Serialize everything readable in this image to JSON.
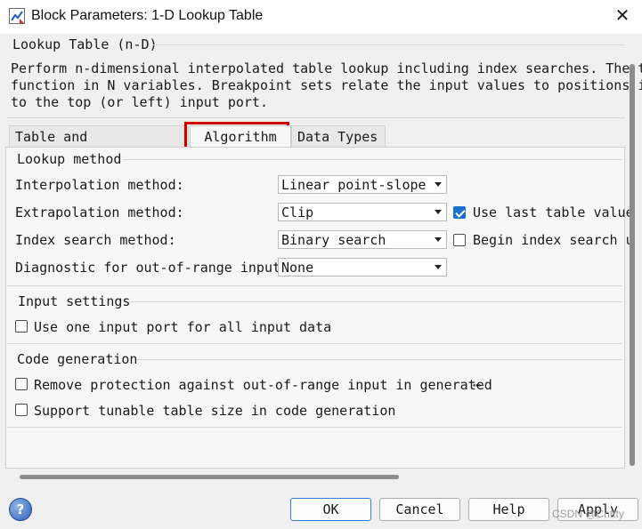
{
  "window": {
    "title": "Block Parameters: 1-D Lookup Table",
    "close_glyph": "✕"
  },
  "block": {
    "name": "Lookup Table (n-D)",
    "description_lines": [
      "Perform n-dimensional interpolated table lookup including index searches. The tab",
      "function in N variables. Breakpoint sets relate the input values to positions in",
      "to the top (or left) input port."
    ]
  },
  "tabs": [
    {
      "label": "Table and Breakpoints",
      "active": false
    },
    {
      "label": "Algorithm",
      "active": true
    },
    {
      "label": "Data Types",
      "active": false
    }
  ],
  "lookup_method": {
    "title": "Lookup method",
    "interpolation": {
      "label": "Interpolation method:",
      "value": "Linear point-slope"
    },
    "extrapolation": {
      "label": "Extrapolation method:",
      "value": "Clip"
    },
    "index_search": {
      "label": "Index search method:",
      "value": "Binary search"
    },
    "diagnostic": {
      "label": "Diagnostic for out-of-range input:",
      "value": "None"
    },
    "use_last_table_value": {
      "label": "Use last table value",
      "checked": true
    },
    "begin_index_search": {
      "label": "Begin index search u",
      "checked": false
    }
  },
  "input_settings": {
    "title": "Input settings",
    "one_input_port": {
      "label": "Use one input port for all input data",
      "checked": false
    }
  },
  "code_generation": {
    "title": "Code generation",
    "remove_protection": {
      "label": "Remove protection against out-of-range input in generated",
      "checked": false,
      "ellipsis": "⋯"
    },
    "tunable_size": {
      "label": "Support tunable table size in code generation",
      "checked": false
    }
  },
  "buttons": {
    "ok": "OK",
    "cancel": "Cancel",
    "help": "Help",
    "apply": "Apply"
  },
  "help_icon_glyph": "?",
  "watermark": "CSDN @Cnttty",
  "colors": {
    "highlight": "#d40000",
    "checkbox_checked": "#1a6fd1",
    "background": "#f0f0f0"
  }
}
